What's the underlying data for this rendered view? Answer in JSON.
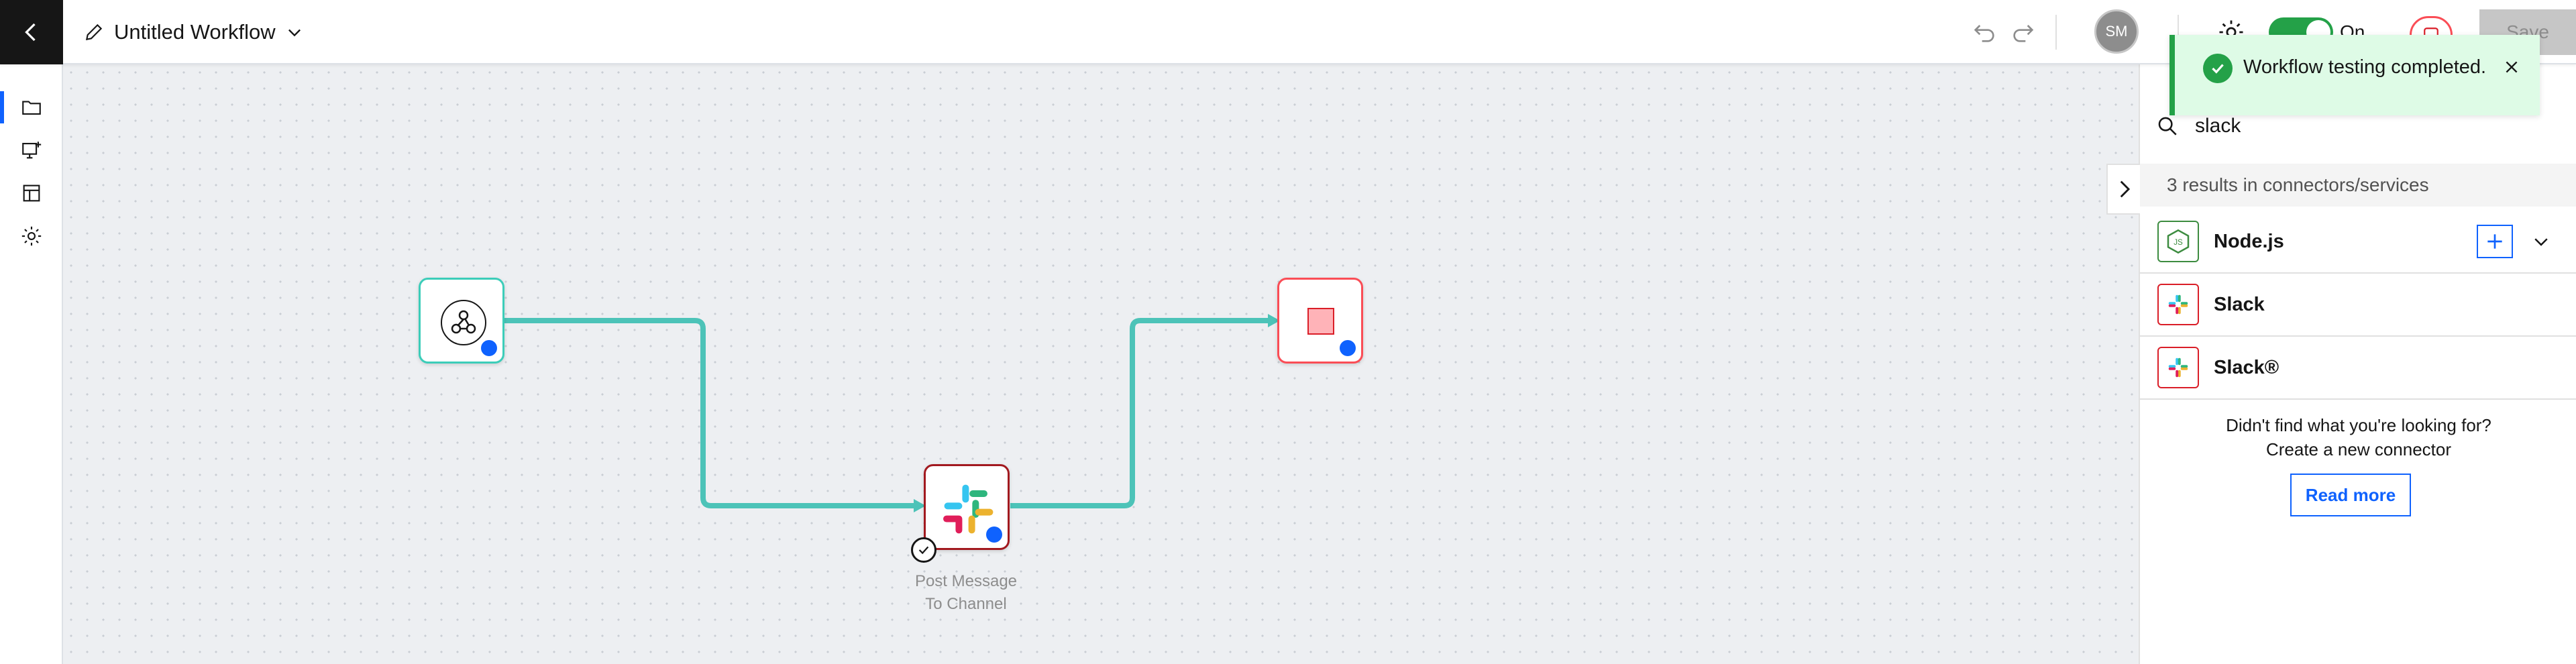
{
  "header": {
    "title": "Untitled Workflow",
    "avatar_initials": "SM",
    "toggle_label": "On",
    "toggle_on": true,
    "save_label": "Save",
    "icons": [
      "back-arrow-icon",
      "pencil-icon",
      "chevron-down-icon",
      "undo-icon",
      "redo-icon",
      "settings-icon",
      "stop-icon"
    ]
  },
  "left_rail": {
    "items": [
      {
        "icon": "folder-icon",
        "active": true
      },
      {
        "icon": "monitor-add-icon",
        "active": false
      },
      {
        "icon": "layout-icon",
        "active": false
      },
      {
        "icon": "settings-icon",
        "active": false
      }
    ]
  },
  "canvas": {
    "nodes": [
      {
        "type": "trigger",
        "icon": "webhook-icon"
      },
      {
        "type": "action",
        "icon": "slack-icon",
        "label_line1": "Post Message",
        "label_line2": "To Channel",
        "tested": true
      },
      {
        "type": "end",
        "icon": "stop-square-icon"
      }
    ],
    "edge_color": "#4cc3b8"
  },
  "panel": {
    "search_value": "slack",
    "results_summary": "3 results in connectors/services",
    "results": [
      {
        "name": "Node.js",
        "logo": "nodejs-icon",
        "has_add": true
      },
      {
        "name": "Slack",
        "logo": "slack-icon"
      },
      {
        "name": "Slack®",
        "logo": "slack-icon"
      }
    ],
    "not_found_line1": "Didn't find what you're looking for?",
    "not_found_line2": "Create a new connector",
    "read_more": "Read more"
  },
  "toast": {
    "message": "Workflow testing completed.",
    "kind": "success"
  },
  "colors": {
    "accent": "#0f62fe",
    "success": "#24a148",
    "danger": "#da1e28",
    "teal": "#4cc3b8"
  }
}
